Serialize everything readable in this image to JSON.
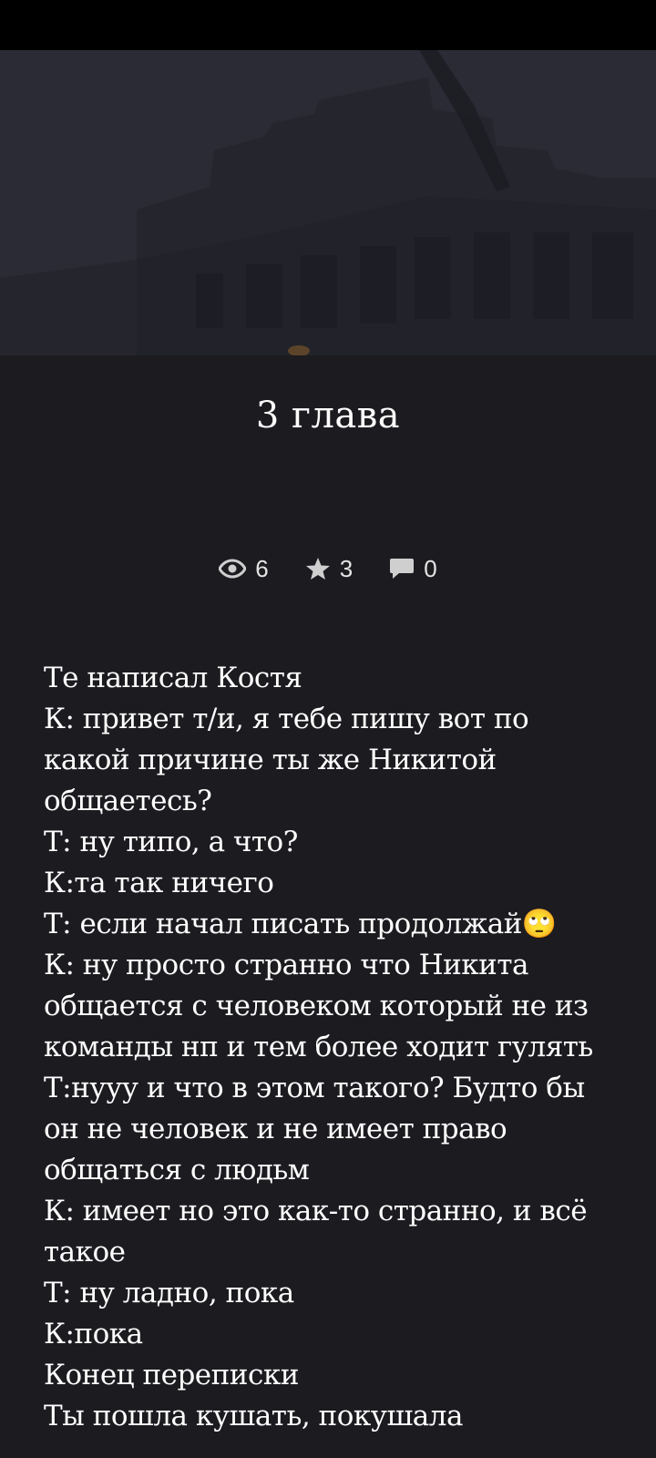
{
  "chapter": {
    "title": "3 глава"
  },
  "stats": {
    "views": "6",
    "stars": "3",
    "comments": "0"
  },
  "icons": {
    "views": "eye-icon",
    "stars": "star-icon",
    "comments": "comment-icon"
  },
  "colors": {
    "background": "#1c1b1f",
    "status_bar": "#000000",
    "text": "#ffffff",
    "icon": "#cfcfcf"
  },
  "story": {
    "lines": [
      "Те написал Костя",
      "К: привет т/и, я тебе пишу вот по какой причине ты же Никитой общаетесь?",
      "Т: ну типо, а что?",
      "К:та так ничего",
      "Т: если начал писать продолжай🙄",
      "К: ну просто странно что Никита общается с человеком который не из команды нп и тем более ходит гулять",
      "Т:нууу и что в этом такого? Будто бы он не человек и не имеет право общаться с людьм",
      "К: имеет но это как-то странно, и всё такое",
      "Т: ну ладно, пока",
      "К:пока",
      "Конец переписки",
      "Ты пошла кушать, покушала"
    ]
  }
}
